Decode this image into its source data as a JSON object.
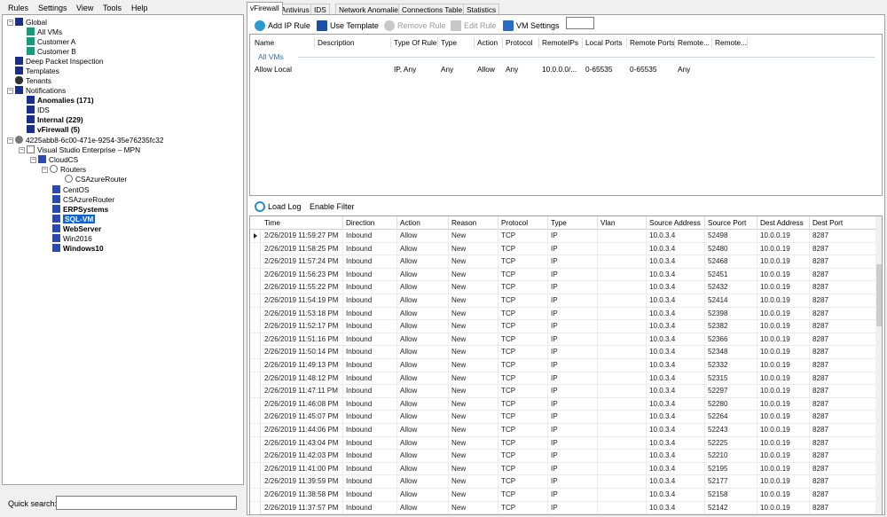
{
  "menu": [
    "Rules",
    "Settings",
    "View",
    "Tools",
    "Help"
  ],
  "tree": {
    "global": "Global",
    "all_vms": "All VMs",
    "customer_a": "Customer A",
    "customer_b": "Customer B",
    "dpi": "Deep Packet Inspection",
    "templates": "Templates",
    "tenants": "Tenants",
    "notifications": "Notifications",
    "anomalies": "Anomalies (171)",
    "ids": "IDS",
    "internal": "Internal (229)",
    "vfirewall": "vFirewall (5)",
    "subscription_id": "4225abb8-6c00-471e-9254-35e76235fc32",
    "subscription": "Visual Studio Enterprise – MPN",
    "cloud": "CloudCS",
    "routers": "Routers",
    "router": "CSAzureRouter",
    "vms": [
      {
        "label": "CentOS",
        "bold": false,
        "selected": false
      },
      {
        "label": "CSAzureRouter",
        "bold": false,
        "selected": false
      },
      {
        "label": "ERPSystems",
        "bold": true,
        "selected": false
      },
      {
        "label": "SQL-VM",
        "bold": true,
        "selected": true
      },
      {
        "label": "WebServer",
        "bold": true,
        "selected": false
      },
      {
        "label": "Win2016",
        "bold": false,
        "selected": false
      },
      {
        "label": "Windows10",
        "bold": true,
        "selected": false
      }
    ]
  },
  "quick_search": {
    "label": "Quick search:",
    "value": ""
  },
  "tabs": [
    "vFirewall",
    "Antivirus",
    "IDS",
    "Network Anomalies",
    "Connections Table",
    "Statistics"
  ],
  "toolbar": {
    "add_ip_rule": "Add IP Rule",
    "use_template": "Use Template",
    "remove_rule": "Remove Rule",
    "edit_rule": "Edit Rule",
    "vm_settings": "VM Settings"
  },
  "rules_table": {
    "columns": [
      "Name",
      "Description",
      "Type Of Rule",
      "Type",
      "Action",
      "Protocol",
      "RemoteIPs",
      "Local Ports",
      "Remote Ports",
      "Remote...",
      "Remote..."
    ],
    "group": "All VMs",
    "rows": [
      [
        "Allow Local",
        "",
        "IP, Any",
        "Any",
        "Allow",
        "Any",
        "10.0.0.0/...",
        "0-65535",
        "0-65535",
        "Any",
        ""
      ]
    ]
  },
  "log_bar": {
    "load_log": "Load Log",
    "enable_filter": "Enable Filter"
  },
  "log_table": {
    "columns": [
      "Time",
      "Direction",
      "Action",
      "Reason",
      "Protocol",
      "Type",
      "Vlan",
      "Source Address",
      "Source Port",
      "Dest Address",
      "Dest Port"
    ],
    "rows": [
      [
        "2/26/2019 11:59:27 PM",
        "Inbound",
        "Allow",
        "New",
        "TCP",
        "IP",
        "",
        "10.0.3.4",
        "52498",
        "10.0.0.19",
        "8287"
      ],
      [
        "2/26/2019 11:58:25 PM",
        "Inbound",
        "Allow",
        "New",
        "TCP",
        "IP",
        "",
        "10.0.3.4",
        "52480",
        "10.0.0.19",
        "8287"
      ],
      [
        "2/26/2019 11:57:24 PM",
        "Inbound",
        "Allow",
        "New",
        "TCP",
        "IP",
        "",
        "10.0.3.4",
        "52468",
        "10.0.0.19",
        "8287"
      ],
      [
        "2/26/2019 11:56:23 PM",
        "Inbound",
        "Allow",
        "New",
        "TCP",
        "IP",
        "",
        "10.0.3.4",
        "52451",
        "10.0.0.19",
        "8287"
      ],
      [
        "2/26/2019 11:55:22 PM",
        "Inbound",
        "Allow",
        "New",
        "TCP",
        "IP",
        "",
        "10.0.3.4",
        "52432",
        "10.0.0.19",
        "8287"
      ],
      [
        "2/26/2019 11:54:19 PM",
        "Inbound",
        "Allow",
        "New",
        "TCP",
        "IP",
        "",
        "10.0.3.4",
        "52414",
        "10.0.0.19",
        "8287"
      ],
      [
        "2/26/2019 11:53:18 PM",
        "Inbound",
        "Allow",
        "New",
        "TCP",
        "IP",
        "",
        "10.0.3.4",
        "52398",
        "10.0.0.19",
        "8287"
      ],
      [
        "2/26/2019 11:52:17 PM",
        "Inbound",
        "Allow",
        "New",
        "TCP",
        "IP",
        "",
        "10.0.3.4",
        "52382",
        "10.0.0.19",
        "8287"
      ],
      [
        "2/26/2019 11:51:16 PM",
        "Inbound",
        "Allow",
        "New",
        "TCP",
        "IP",
        "",
        "10.0.3.4",
        "52366",
        "10.0.0.19",
        "8287"
      ],
      [
        "2/26/2019 11:50:14 PM",
        "Inbound",
        "Allow",
        "New",
        "TCP",
        "IP",
        "",
        "10.0.3.4",
        "52348",
        "10.0.0.19",
        "8287"
      ],
      [
        "2/26/2019 11:49:13 PM",
        "Inbound",
        "Allow",
        "New",
        "TCP",
        "IP",
        "",
        "10.0.3.4",
        "52332",
        "10.0.0.19",
        "8287"
      ],
      [
        "2/26/2019 11:48:12 PM",
        "Inbound",
        "Allow",
        "New",
        "TCP",
        "IP",
        "",
        "10.0.3.4",
        "52315",
        "10.0.0.19",
        "8287"
      ],
      [
        "2/26/2019 11:47:11 PM",
        "Inbound",
        "Allow",
        "New",
        "TCP",
        "IP",
        "",
        "10.0.3.4",
        "52297",
        "10.0.0.19",
        "8287"
      ],
      [
        "2/26/2019 11:46:08 PM",
        "Inbound",
        "Allow",
        "New",
        "TCP",
        "IP",
        "",
        "10.0.3.4",
        "52280",
        "10.0.0.19",
        "8287"
      ],
      [
        "2/26/2019 11:45:07 PM",
        "Inbound",
        "Allow",
        "New",
        "TCP",
        "IP",
        "",
        "10.0.3.4",
        "52264",
        "10.0.0.19",
        "8287"
      ],
      [
        "2/26/2019 11:44:06 PM",
        "Inbound",
        "Allow",
        "New",
        "TCP",
        "IP",
        "",
        "10.0.3.4",
        "52243",
        "10.0.0.19",
        "8287"
      ],
      [
        "2/26/2019 11:43:04 PM",
        "Inbound",
        "Allow",
        "New",
        "TCP",
        "IP",
        "",
        "10.0.3.4",
        "52225",
        "10.0.0.19",
        "8287"
      ],
      [
        "2/26/2019 11:42:03 PM",
        "Inbound",
        "Allow",
        "New",
        "TCP",
        "IP",
        "",
        "10.0.3.4",
        "52210",
        "10.0.0.19",
        "8287"
      ],
      [
        "2/26/2019 11:41:00 PM",
        "Inbound",
        "Allow",
        "New",
        "TCP",
        "IP",
        "",
        "10.0.3.4",
        "52195",
        "10.0.0.19",
        "8287"
      ],
      [
        "2/26/2019 11:39:59 PM",
        "Inbound",
        "Allow",
        "New",
        "TCP",
        "IP",
        "",
        "10.0.3.4",
        "52177",
        "10.0.0.19",
        "8287"
      ],
      [
        "2/26/2019 11:38:58 PM",
        "Inbound",
        "Allow",
        "New",
        "TCP",
        "IP",
        "",
        "10.0.3.4",
        "52158",
        "10.0.0.19",
        "8287"
      ],
      [
        "2/26/2019 11:37:57 PM",
        "Inbound",
        "Allow",
        "New",
        "TCP",
        "IP",
        "",
        "10.0.3.4",
        "52142",
        "10.0.0.19",
        "8287"
      ]
    ]
  },
  "colors": {
    "selection": "#0a64d8",
    "group_text": "#3c6ea8",
    "tree_icon": "#1a2f8a",
    "vm_icon": "#2a49b8",
    "green": "#1a9a7a"
  }
}
